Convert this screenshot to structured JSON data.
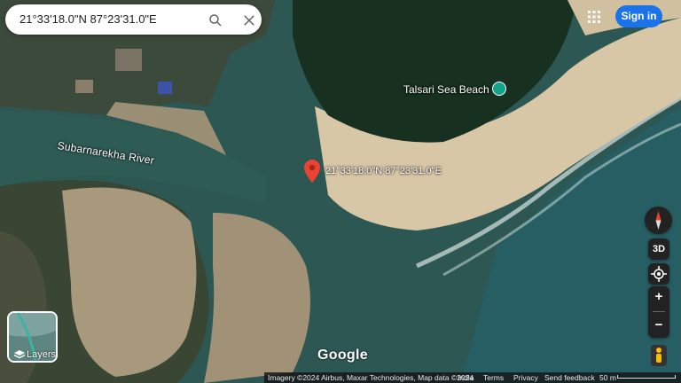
{
  "search": {
    "value": "21°33'18.0\"N 87°23'31.0\"E",
    "search_icon": "search-icon",
    "close_icon": "close-icon"
  },
  "header": {
    "apps_icon": "apps-grid-icon",
    "sign_in_label": "Sign in",
    "sign_in_color": "#1a73e8"
  },
  "map": {
    "river_label": "Subarnarekha River",
    "place_label": "Talsari Sea Beach",
    "place_icon": "beach-icon",
    "pin_label": "21°33'18.0\"N 87°23'31.0\"E",
    "pin_icon": "location-pin-icon",
    "pin_color": "#ea4335"
  },
  "controls": {
    "compass_icon": "compass-icon",
    "three_d_label": "3D",
    "locate_icon": "my-location-icon",
    "zoom_in_label": "+",
    "zoom_out_label": "−",
    "pegman_icon": "pegman-icon"
  },
  "layers": {
    "label": "Layers",
    "icon": "layers-icon"
  },
  "logo": "Google",
  "footer": {
    "attribution": "Imagery ©2024 Airbus, Maxar Technologies, Map data ©2024",
    "country": "India",
    "terms": "Terms",
    "privacy": "Privacy",
    "feedback": "Send feedback",
    "scale": "50 m"
  }
}
